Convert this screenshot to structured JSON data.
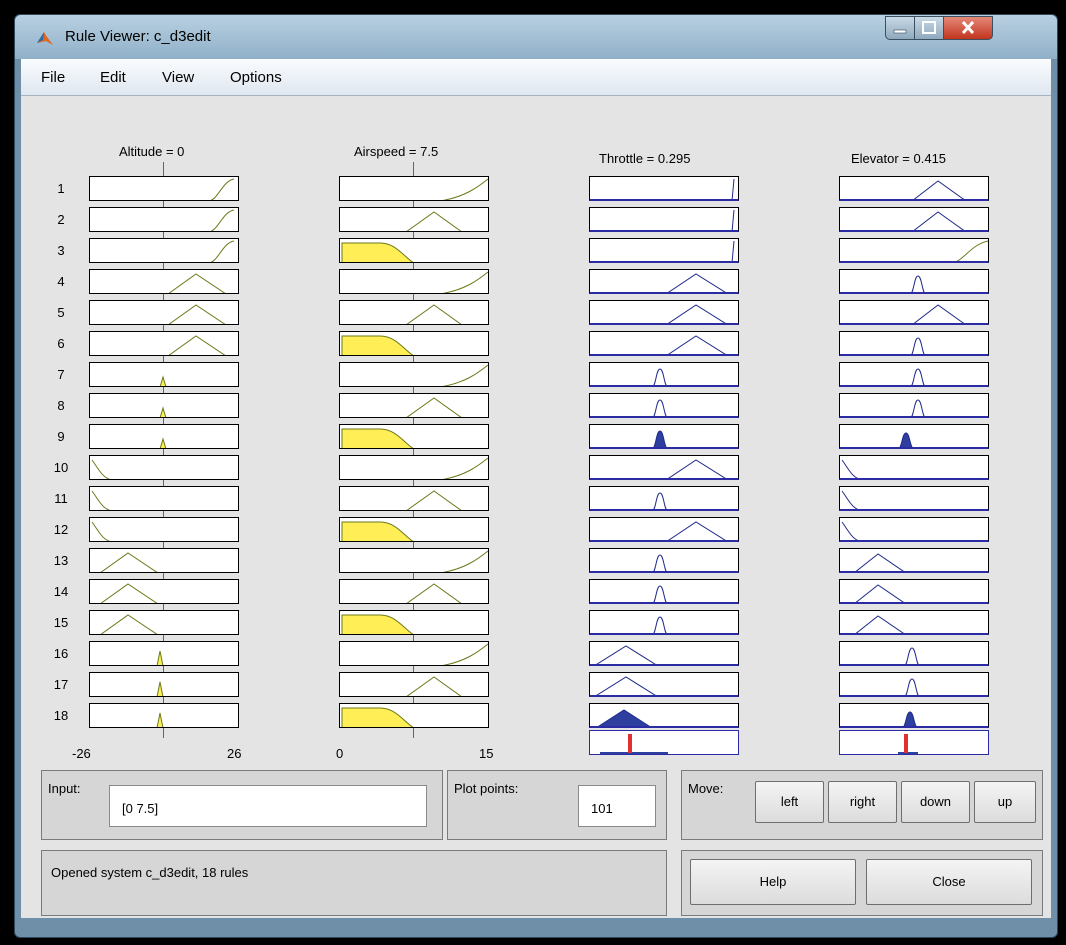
{
  "window": {
    "title": "Rule Viewer: c_d3edit"
  },
  "menu": [
    "File",
    "Edit",
    "View",
    "Options"
  ],
  "columns": [
    {
      "header": "Altitude = 0",
      "range_min": "-26",
      "range_max": "26"
    },
    {
      "header": "Airspeed = 7.5",
      "range_min": "0",
      "range_max": "15"
    },
    {
      "header": "Throttle = 0.295"
    },
    {
      "header": "Elevator = 0.415"
    }
  ],
  "rules": [
    "1",
    "2",
    "3",
    "4",
    "5",
    "6",
    "7",
    "8",
    "9",
    "10",
    "11",
    "12",
    "13",
    "14",
    "15",
    "16",
    "17",
    "18"
  ],
  "input": {
    "label": "Input:",
    "value": "[0 7.5]"
  },
  "plot_points": {
    "label": "Plot points:",
    "value": "101"
  },
  "move": {
    "label": "Move:",
    "left": "left",
    "right": "right",
    "down": "down",
    "up": "up"
  },
  "status": "Opened system c_d3edit, 18 rules",
  "buttons": {
    "help": "Help",
    "close": "Close"
  },
  "colors": {
    "input_mf": "#6b7a1a",
    "input_fill": "#ffee55",
    "output_mf": "#1f2a8c",
    "output_fill": "#2f3fa0",
    "indicator": "#e03030"
  }
}
